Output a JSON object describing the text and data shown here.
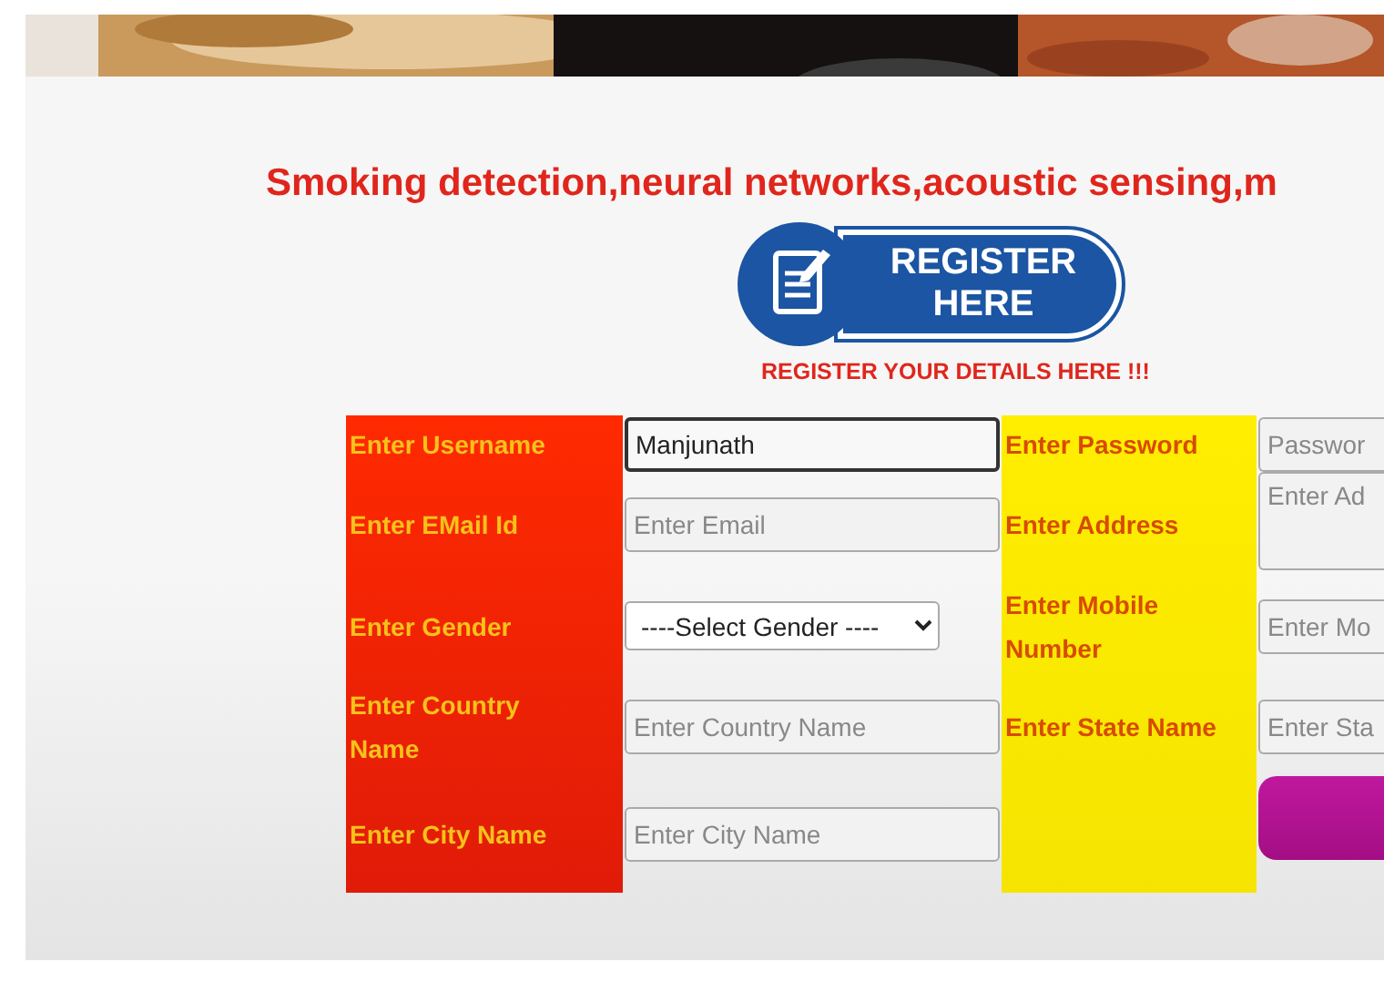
{
  "heading": "Smoking detection,neural networks,acoustic sensing,m",
  "register_logo": {
    "line_1": "REGISTER",
    "line_2": "HERE"
  },
  "subtitle": "REGISTER YOUR DETAILS HERE !!!",
  "form": {
    "left": [
      {
        "label": "Enter Username",
        "kind": "text",
        "value": "Manjunath",
        "focused": true
      },
      {
        "label": "Enter EMail Id",
        "kind": "text",
        "placeholder": "Enter Email",
        "focused": false
      },
      {
        "label": "Enter Gender",
        "kind": "select",
        "value": "----Select Gender ----"
      },
      {
        "label": "Enter Country Name",
        "kind": "text",
        "placeholder": "Enter Country Name",
        "focused": false
      },
      {
        "label": "Enter City Name",
        "kind": "text",
        "placeholder": "Enter City Name",
        "focused": false
      }
    ],
    "right": [
      {
        "label": "Enter Password",
        "kind": "text",
        "placeholder": "Passwor",
        "focused": false
      },
      {
        "label": "Enter Address",
        "kind": "textarea",
        "placeholder": "Enter Ad",
        "focused": false
      },
      {
        "label": "Enter Mobile Number",
        "kind": "text",
        "placeholder": "Enter Mo",
        "focused": false
      },
      {
        "label": "Enter State Name",
        "kind": "text",
        "placeholder": "Enter Sta",
        "focused": false
      },
      {
        "kind": "button"
      }
    ]
  }
}
